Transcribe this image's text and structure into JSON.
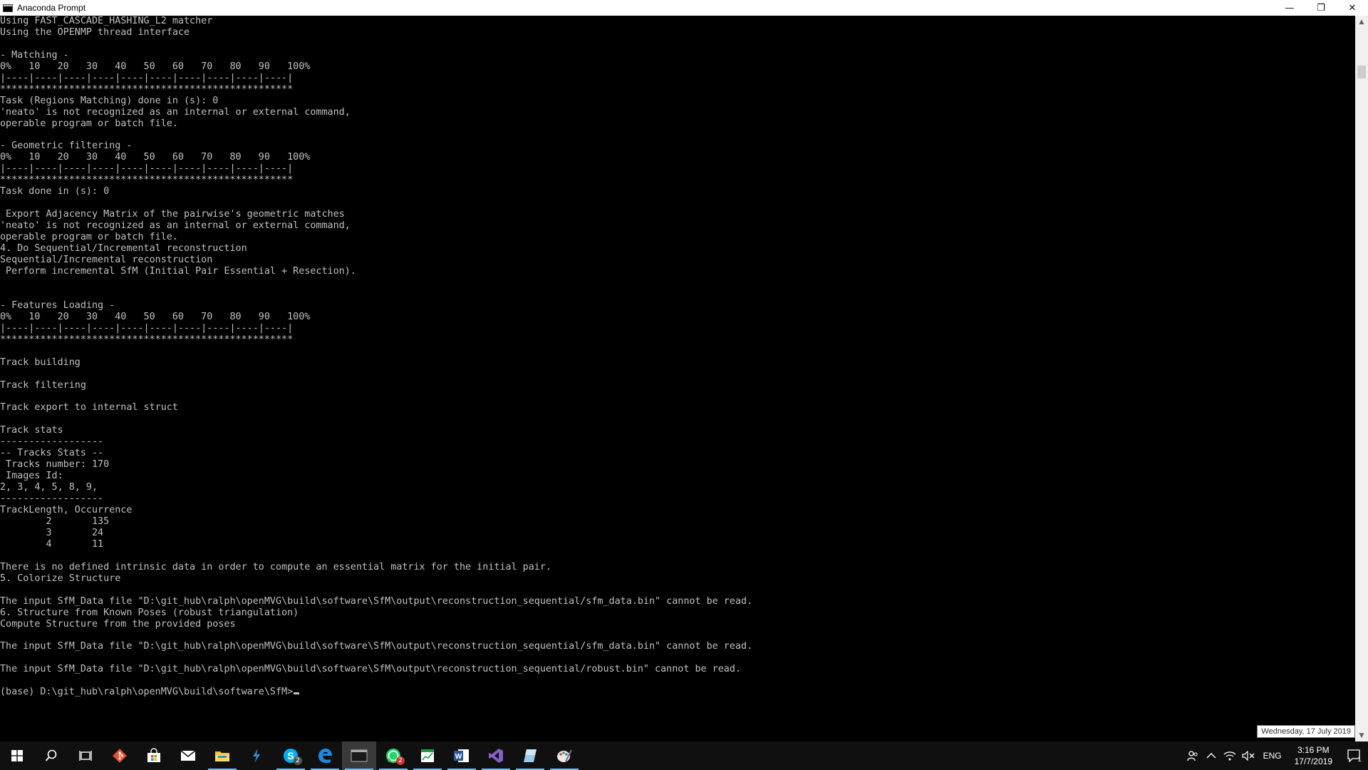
{
  "window": {
    "title": "Anaconda Prompt",
    "controls": {
      "minimize": "—",
      "maximize": "❐",
      "close": "✕"
    }
  },
  "console": {
    "lines": [
      "Using FAST_CASCADE_HASHING_L2 matcher",
      "Using the OPENMP thread interface",
      "",
      "- Matching -",
      "0%   10   20   30   40   50   60   70   80   90   100%",
      "|----|----|----|----|----|----|----|----|----|----|",
      "***************************************************",
      "Task (Regions Matching) done in (s): 0",
      "'neato' is not recognized as an internal or external command,",
      "operable program or batch file.",
      "",
      "- Geometric filtering -",
      "0%   10   20   30   40   50   60   70   80   90   100%",
      "|----|----|----|----|----|----|----|----|----|----|",
      "***************************************************",
      "Task done in (s): 0",
      "",
      " Export Adjacency Matrix of the pairwise's geometric matches",
      "'neato' is not recognized as an internal or external command,",
      "operable program or batch file.",
      "4. Do Sequential/Incremental reconstruction",
      "Sequential/Incremental reconstruction",
      " Perform incremental SfM (Initial Pair Essential + Resection).",
      "",
      "",
      "- Features Loading -",
      "0%   10   20   30   40   50   60   70   80   90   100%",
      "|----|----|----|----|----|----|----|----|----|----|",
      "***************************************************",
      "",
      "Track building",
      "",
      "Track filtering",
      "",
      "Track export to internal struct",
      "",
      "Track stats",
      "------------------",
      "-- Tracks Stats --",
      " Tracks number: 170",
      " Images Id:",
      "2, 3, 4, 5, 8, 9,",
      "------------------",
      "TrackLength, Occurrence",
      "        2       135",
      "        3       24",
      "        4       11",
      "",
      "There is no defined intrinsic data in order to compute an essential matrix for the initial pair.",
      "5. Colorize Structure",
      "",
      "The input SfM_Data file \"D:\\git_hub\\ralph\\openMVG\\build\\software\\SfM\\output\\reconstruction_sequential/sfm_data.bin\" cannot be read.",
      "6. Structure from Known Poses (robust triangulation)",
      "Compute Structure from the provided poses",
      "",
      "The input SfM_Data file \"D:\\git_hub\\ralph\\openMVG\\build\\software\\SfM\\output\\reconstruction_sequential/sfm_data.bin\" cannot be read.",
      "",
      "The input SfM_Data file \"D:\\git_hub\\ralph\\openMVG\\build\\software\\SfM\\output\\reconstruction_sequential/robust.bin\" cannot be read.",
      ""
    ],
    "prompt": "(base) D:\\git_hub\\ralph\\openMVG\\build\\software\\SfM>"
  },
  "tooltip": {
    "date_long": "Wednesday, 17 July 2019"
  },
  "taskbar": {
    "apps": [
      {
        "name": "start-button",
        "icon": "windows-logo-icon"
      },
      {
        "name": "search-button",
        "icon": "search-icon"
      },
      {
        "name": "task-view-button",
        "icon": "task-view-icon"
      },
      {
        "name": "git-app",
        "icon": "git-icon"
      },
      {
        "name": "store-app",
        "icon": "store-icon"
      },
      {
        "name": "mail-app",
        "icon": "mail-icon"
      },
      {
        "name": "file-explorer-app",
        "icon": "folder-icon"
      },
      {
        "name": "vscode-app",
        "icon": "vscode-icon"
      },
      {
        "name": "skype-app",
        "icon": "skype-icon",
        "badge": "2"
      },
      {
        "name": "edge-app",
        "icon": "edge-icon"
      },
      {
        "name": "anaconda-prompt-app",
        "icon": "terminal-icon"
      },
      {
        "name": "whatsapp-app",
        "icon": "whatsapp-icon",
        "badge": "2"
      },
      {
        "name": "spreadsheet-app",
        "icon": "spreadsheet-icon"
      },
      {
        "name": "word-app",
        "icon": "word-icon"
      },
      {
        "name": "visual-studio-app",
        "icon": "visual-studio-icon"
      },
      {
        "name": "notes-app",
        "icon": "notes-icon"
      },
      {
        "name": "paint-app",
        "icon": "paint-icon"
      }
    ],
    "tray": {
      "language": "ENG",
      "time": "3:16 PM",
      "date": "17/7/2019",
      "notification_count": "1"
    }
  },
  "colors": {
    "console_bg": "#000000",
    "console_text": "#c0c0c0",
    "taskbar_bg": "#101010",
    "accent": "#76b9ed"
  }
}
